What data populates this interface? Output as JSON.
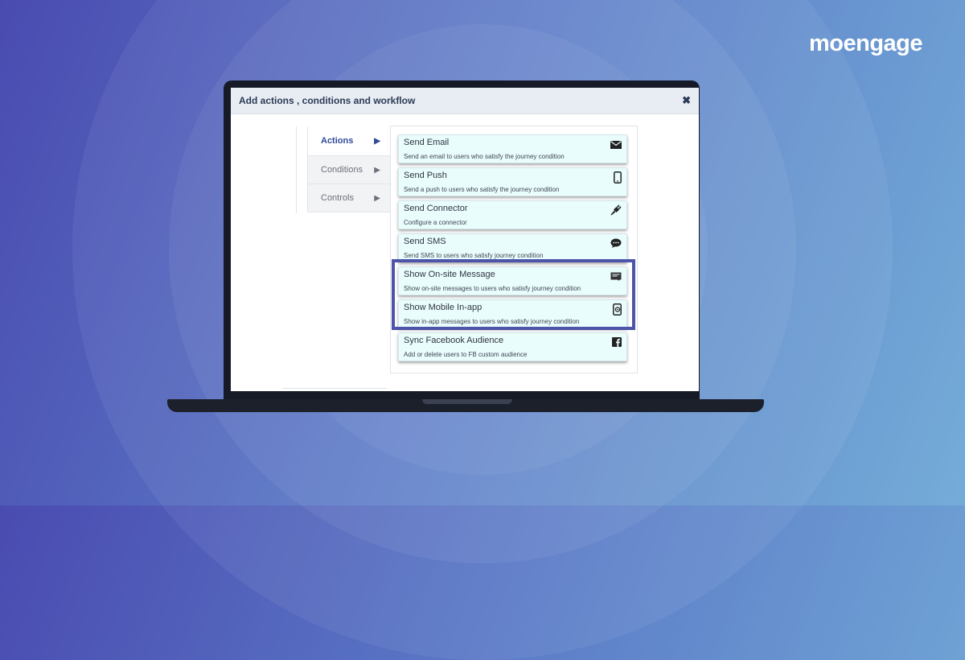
{
  "brand": {
    "logo_text": "moengage"
  },
  "modal": {
    "title": "Add actions , conditions and workflow",
    "close_symbol": "✖"
  },
  "menu": {
    "items": [
      {
        "label": "Actions",
        "active": true
      },
      {
        "label": "Conditions",
        "active": false
      },
      {
        "label": "Controls",
        "active": false
      }
    ],
    "arrow_symbol": "▶"
  },
  "actions": [
    {
      "title": "Send Email",
      "desc": "Send an email to users who satisfy the journey condition",
      "icon": "envelope-icon"
    },
    {
      "title": "Send Push",
      "desc": "Send a push to users who satisfy the journey condition",
      "icon": "mobile-phone-icon"
    },
    {
      "title": "Send Connector",
      "desc": "Configure a connector",
      "icon": "plug-icon"
    },
    {
      "title": "Send SMS",
      "desc": "Send SMS to users who satisfy journey condition",
      "icon": "chat-bubble-icon"
    },
    {
      "title": "Show On-site Message",
      "desc": "Show on-site messages to users who satisfy journey condition",
      "icon": "onsite-message-icon"
    },
    {
      "title": "Show Mobile In-app",
      "desc": "Show in-app messages to users who satisfy journey condition",
      "icon": "mobile-inapp-icon"
    },
    {
      "title": "Sync Facebook Audience",
      "desc": "Add or delete users to FB custom audience",
      "icon": "facebook-icon"
    }
  ],
  "colors": {
    "background_start": "#4a4bb0",
    "background_end": "#74acd8",
    "highlight": "#4c55a9",
    "card_bg": "#e9fdfd",
    "active_menu_text": "#2f4a9a"
  }
}
